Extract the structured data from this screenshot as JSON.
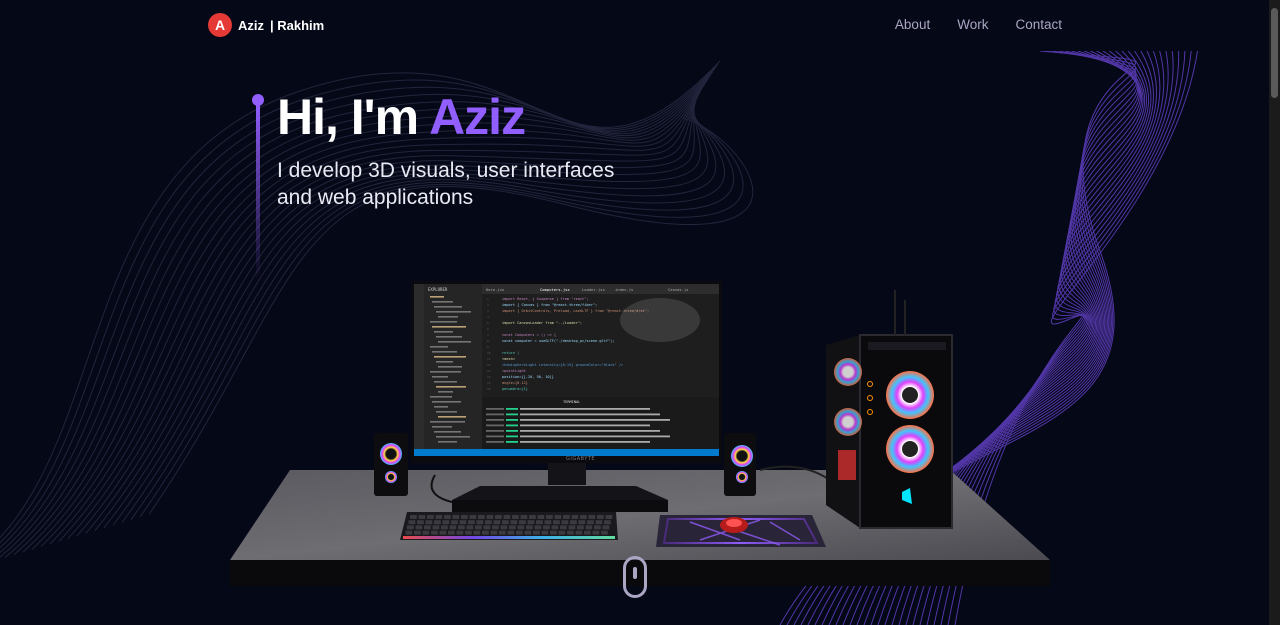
{
  "nav": {
    "brand_name": "Aziz",
    "brand_surname": "| Rakhim",
    "logo_letter": "A",
    "links": [
      "About",
      "Work",
      "Contact"
    ]
  },
  "hero": {
    "greeting": "Hi, I'm ",
    "name": "Aziz",
    "subtitle": "I develop 3D visuals, user interfaces and web applications"
  },
  "monitor": {
    "brand_label": "GIGABYTE",
    "editor": {
      "sidebar_title": "EXPLORER",
      "tabs": [
        "Hero.jsx",
        "Computers.jsx",
        "Loader.jsx",
        "index.js",
        "Canvas.js"
      ],
      "terminal_tab": "TERMINAL",
      "code_lines": [
        "import React, { Suspense } from \"react\";",
        "import { Canvas } from \"@react-three/fiber\";",
        "import { OrbitControls, Preload, useGLTF } from \"@react-three/drei\";",
        "",
        "import CanvasLoader from \"../Loader\";",
        "",
        "const Computers = () => {",
        "  const computer = useGLTF(\"./desktop_pc/scene.gltf\");",
        "",
        "  return (",
        "    <mesh>",
        "      <hemisphereLight intensity={0.15} groundColor=\"black\" />",
        "      <pointLight",
        "        position={[-20, 50, 10]}",
        "        angle={0.12}",
        "        penumbra={1}"
      ]
    }
  },
  "colors": {
    "background": "#050816",
    "accent": "#915eff",
    "secondary_text": "#aaa6c3",
    "logo": "#e53935"
  }
}
